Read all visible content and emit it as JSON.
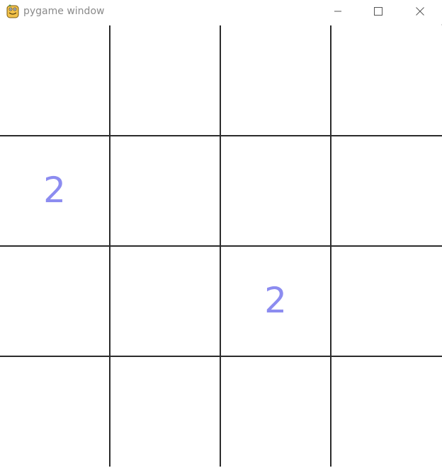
{
  "window": {
    "title": "pygame window",
    "icon": "pygame-snake-icon",
    "controls": [
      "minimize-icon",
      "maximize-icon",
      "close-icon"
    ]
  },
  "board": {
    "rows": 4,
    "cols": 4,
    "tiles": [
      [
        "",
        "",
        "",
        ""
      ],
      [
        "2",
        "",
        "",
        ""
      ],
      [
        "",
        "",
        "2",
        ""
      ],
      [
        "",
        "",
        "",
        ""
      ]
    ],
    "colors": {
      "background": "#ffffff",
      "grid_line": "#2b2b2b",
      "tile_text": "#8c8cf0"
    }
  }
}
